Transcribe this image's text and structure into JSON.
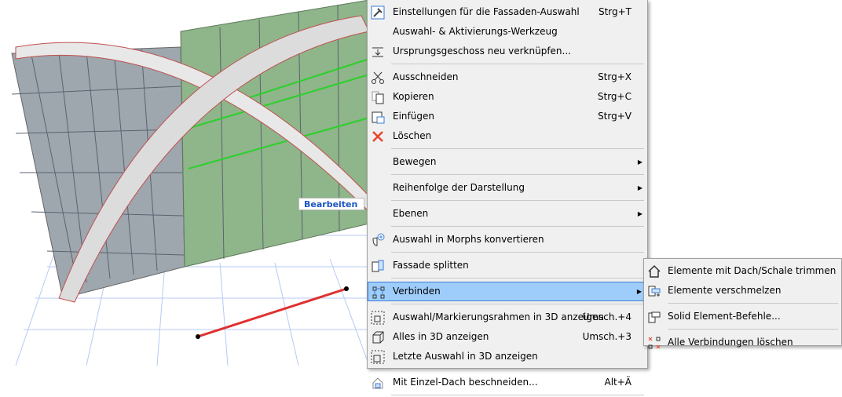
{
  "tooltip": "Bearbeiten",
  "menu": {
    "items": [
      {
        "label": "Einstellungen für die Fassaden-Auswahl",
        "shortcut": "Strg+T",
        "icon": "settings-hammer-icon"
      },
      {
        "label": "Auswahl- & Aktivierungs-Werkzeug"
      },
      {
        "label": "Ursprungsgeschoss neu verknüpfen...",
        "icon": "story-link-icon"
      },
      {
        "label": "Ausschneiden",
        "shortcut": "Strg+X",
        "icon": "scissors-icon"
      },
      {
        "label": "Kopieren",
        "shortcut": "Strg+C",
        "icon": "copy-icon"
      },
      {
        "label": "Einfügen",
        "shortcut": "Strg+V",
        "icon": "paste-icon"
      },
      {
        "label": "Löschen",
        "icon": "delete-x-icon"
      },
      {
        "label": "Bewegen"
      },
      {
        "label": "Reihenfolge der Darstellung"
      },
      {
        "label": "Ebenen"
      },
      {
        "label": "Auswahl in Morphs konvertieren",
        "icon": "morph-icon"
      },
      {
        "label": "Fassade splitten",
        "icon": "facade-split-icon"
      },
      {
        "label": "Verbinden",
        "icon": "connect-icon"
      },
      {
        "label": "Auswahl/Markierungsrahmen in 3D anzeigen",
        "shortcut": "Umsch.+4",
        "icon": "cube-dashed-icon"
      },
      {
        "label": "Alles in 3D anzeigen",
        "shortcut": "Umsch.+3",
        "icon": "cube-icon"
      },
      {
        "label": "Letzte Auswahl in 3D anzeigen",
        "icon": "cube-last-icon"
      },
      {
        "label": "Mit Einzel-Dach beschneiden...",
        "shortcut": "Alt+Ä",
        "icon": "roof-trim-icon"
      }
    ]
  },
  "submenu": {
    "items": [
      {
        "label": "Elemente mit Dach/Schale trimmen",
        "icon": "roof-icon"
      },
      {
        "label": "Elemente verschmelzen",
        "icon": "merge-icon"
      },
      {
        "label": "Solid Element-Befehle...",
        "icon": "solid-icon"
      },
      {
        "label": "Alle Verbindungen löschen",
        "icon": "delete-connections-icon"
      }
    ]
  },
  "colors": {
    "highlight": "#9fcdfb",
    "accent": "#3c7fd1"
  }
}
